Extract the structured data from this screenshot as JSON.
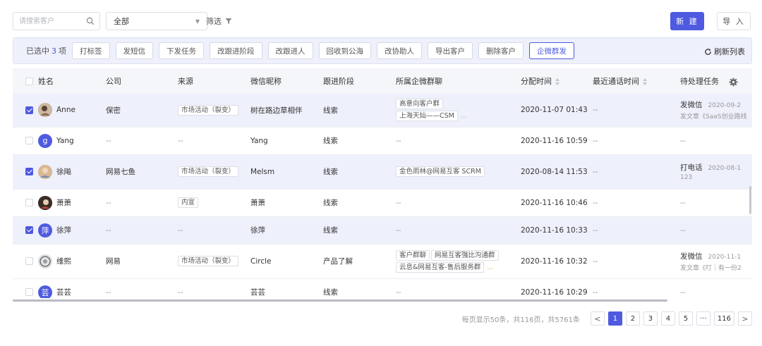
{
  "toolbar": {
    "search_placeholder": "请搜索客户",
    "scope_select": "全部",
    "filter_label": "筛选",
    "new_label": "新 建",
    "import_label": "导 入"
  },
  "batch": {
    "selected_prefix": "已选中",
    "selected_count": "3",
    "selected_suffix": "项",
    "actions": [
      "打标签",
      "发短信",
      "下发任务",
      "改跟进阶段",
      "改跟进人",
      "回收到公海",
      "改协助人",
      "导出客户",
      "删除客户",
      "企微群发"
    ],
    "refresh_label": "刷新列表"
  },
  "table": {
    "headers": {
      "name": "姓名",
      "company": "公司",
      "source": "来源",
      "wechat": "微信昵称",
      "stage": "跟进阶段",
      "groups": "所属企微群聊",
      "assign_time": "分配时间",
      "last_call": "最近通话时间",
      "pending_task": "待处理任务"
    },
    "rows": [
      {
        "checked": true,
        "avatar_text": "",
        "avatar_color": "#b0a090",
        "name": "Anne",
        "company": "保密",
        "source_tag": "市场活动（裂变）",
        "wechat": "树在路边草相伴",
        "stage": "线索",
        "group_tags": [
          "高意向客户群",
          "上海天灿——CSM"
        ],
        "group_more": "...",
        "assign_time": "2020-11-07 01:43",
        "last_call": "--",
        "task": "发微信",
        "task_date": "2020-09-2",
        "task_sub": "发文章《SaaS创业路线"
      },
      {
        "checked": false,
        "avatar_text": "g",
        "avatar_color": "#4e5adf",
        "name": "Yang",
        "company": "--",
        "source_text": "--",
        "wechat": "Yang",
        "stage": "线索",
        "groups_text": "--",
        "assign_time": "2020-11-16 10:59",
        "last_call": "--",
        "task": "--"
      },
      {
        "checked": true,
        "avatar_text": "",
        "avatar_color": "#c9a27a",
        "name": "徐飚",
        "company": "网易七鱼",
        "source_tag": "市场活动（裂变）",
        "wechat": "Melsm",
        "stage": "线索",
        "group_tags": [
          "金色雨林@网易互客 SCRM"
        ],
        "assign_time": "2020-08-14 11:53",
        "last_call": "--",
        "task": "打电话",
        "task_date": "2020-08-1",
        "task_sub": "123"
      },
      {
        "checked": false,
        "avatar_text": "",
        "avatar_color": "#6b5446",
        "name": "萧萧",
        "company": "--",
        "source_tag": "内宣",
        "wechat": "萧萧",
        "stage": "线索",
        "groups_text": "--",
        "assign_time": "2020-11-16 10:46",
        "last_call": "--",
        "task": "--"
      },
      {
        "checked": true,
        "avatar_text": "萍",
        "avatar_color": "#4e5adf",
        "name": "徐萍",
        "company": "--",
        "source_text": "--",
        "wechat": "徐萍",
        "stage": "线索",
        "groups_text": "--",
        "assign_time": "2020-11-16 10:33",
        "last_call": "--",
        "task": "--"
      },
      {
        "checked": false,
        "avatar_text": "",
        "avatar_color": "#8a8d92",
        "name": "维熙",
        "company": "网易",
        "source_tag": "市场活动（裂变）",
        "wechat": "Circle",
        "stage": "产品了解",
        "group_tags": [
          "客户群聊",
          "网易互客强比沟通群",
          "云息&网易互客-售后服务群"
        ],
        "group_more": "...",
        "assign_time": "2020-11-16 10:32",
        "last_call": "--",
        "task": "发微信",
        "task_date": "2020-11-1",
        "task_sub": "发文章《叮｜有一份2"
      },
      {
        "checked": false,
        "avatar_text": "芸",
        "avatar_color": "#4e5adf",
        "name": "芸芸",
        "company": "--",
        "source_text": "--",
        "wechat": "芸芸",
        "stage": "线索",
        "groups_text": "--",
        "assign_time": "2020-11-16 10:29",
        "last_call": "--",
        "task": "--"
      }
    ]
  },
  "pagination": {
    "info": "每页显示50条，共116页，共5761条",
    "prev": "<",
    "pages": [
      "1",
      "2",
      "3",
      "4",
      "5"
    ],
    "active": "1",
    "ellipsis": "···",
    "last": "116",
    "next": ">"
  },
  "colors": {
    "accent": "#4e5adf",
    "selected_row": "#eef0fb",
    "header_bg": "#f5f6f9"
  }
}
